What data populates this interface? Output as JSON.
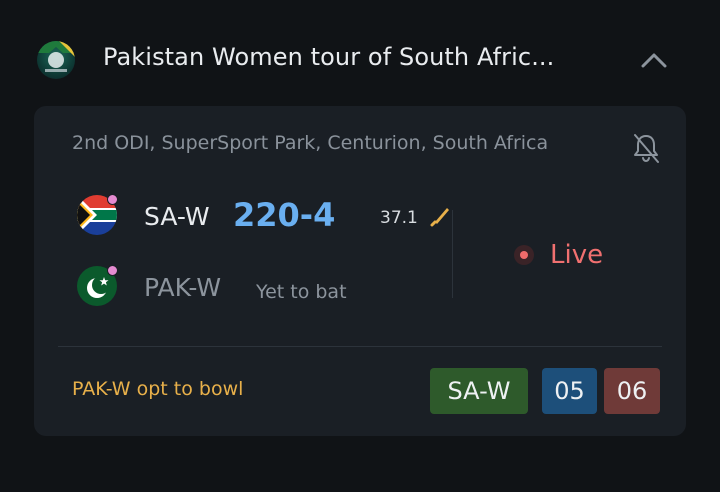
{
  "series": {
    "title": "Pakistan Women tour of South Afric...",
    "logo_icon": "series-logo"
  },
  "match": {
    "venue": "2nd ODI, SuperSport Park, Centurion, South Africa",
    "status": "Live",
    "toss": "PAK-W opt to bowl",
    "teams": [
      {
        "name": "SA-W",
        "score": "220-4",
        "overs": "37.1",
        "batting": true
      },
      {
        "name": "PAK-W",
        "note": "Yet to bat"
      }
    ],
    "footer": {
      "team_label": "SA-W",
      "pill_1": "05",
      "pill_2": "06"
    }
  },
  "colors": {
    "background": "#101316",
    "card": "#1a1f25",
    "score": "#6aaff0",
    "live": "#f07070",
    "toss": "#e8b04a",
    "team_pill": "#2e5a2b",
    "pill_1": "#1d4f7a",
    "pill_2": "#6f3a38"
  }
}
